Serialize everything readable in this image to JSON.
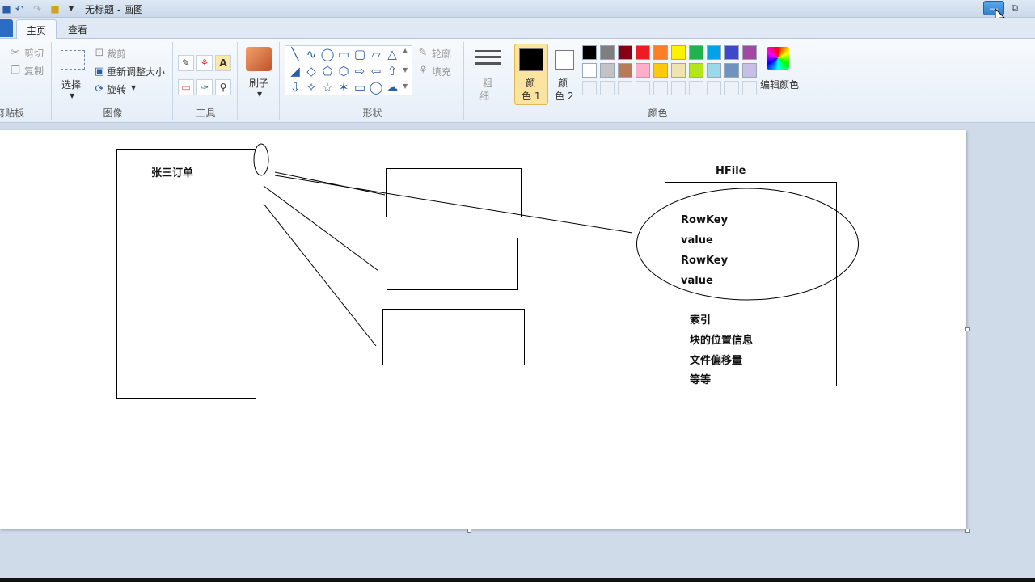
{
  "window": {
    "title": "无标题 - 画图"
  },
  "tabs": [
    {
      "label": "主页"
    },
    {
      "label": "查看"
    }
  ],
  "ribbon": {
    "clipboard": {
      "cut": "剪切",
      "copy": "复制",
      "group_label": "剪贴板"
    },
    "image": {
      "select": "选择",
      "crop": "裁剪",
      "resize": "重新调整大小",
      "rotate": "旋转",
      "group_label": "图像"
    },
    "tools": {
      "group_label": "工具"
    },
    "brushes": {
      "label": "刷子"
    },
    "shapes": {
      "outline": "轮廓",
      "fill": "填充",
      "group_label": "形状"
    },
    "size": {
      "label_top": "粗",
      "label_bottom": "细"
    },
    "colors": {
      "color1_top": "颜",
      "color1_bottom": "色 1",
      "color2_top": "颜",
      "color2_bottom": "色 2",
      "edit": "编辑颜色",
      "group_label": "颜色",
      "palette_row1": [
        "#000000",
        "#7f7f7f",
        "#880015",
        "#ed1c24",
        "#ff7f27",
        "#fff200",
        "#22b14c",
        "#00a2e8",
        "#3f48cc",
        "#a349a4"
      ],
      "palette_row2": [
        "#ffffff",
        "#c3c3c3",
        "#b97a57",
        "#ffaec9",
        "#ffc90e",
        "#efe4b0",
        "#b5e61d",
        "#99d9ea",
        "#7092be",
        "#c8bfe7"
      ],
      "color1": "#000000",
      "color2": "#ffffff"
    }
  },
  "drawing": {
    "order_label": "张三订单",
    "hfile_label": "HFile",
    "hfile_entries": [
      "RowKey",
      "value",
      "RowKey",
      "value"
    ],
    "hfile_meta": [
      "索引",
      "块的位置信息",
      "文件偏移量",
      "等等"
    ]
  }
}
